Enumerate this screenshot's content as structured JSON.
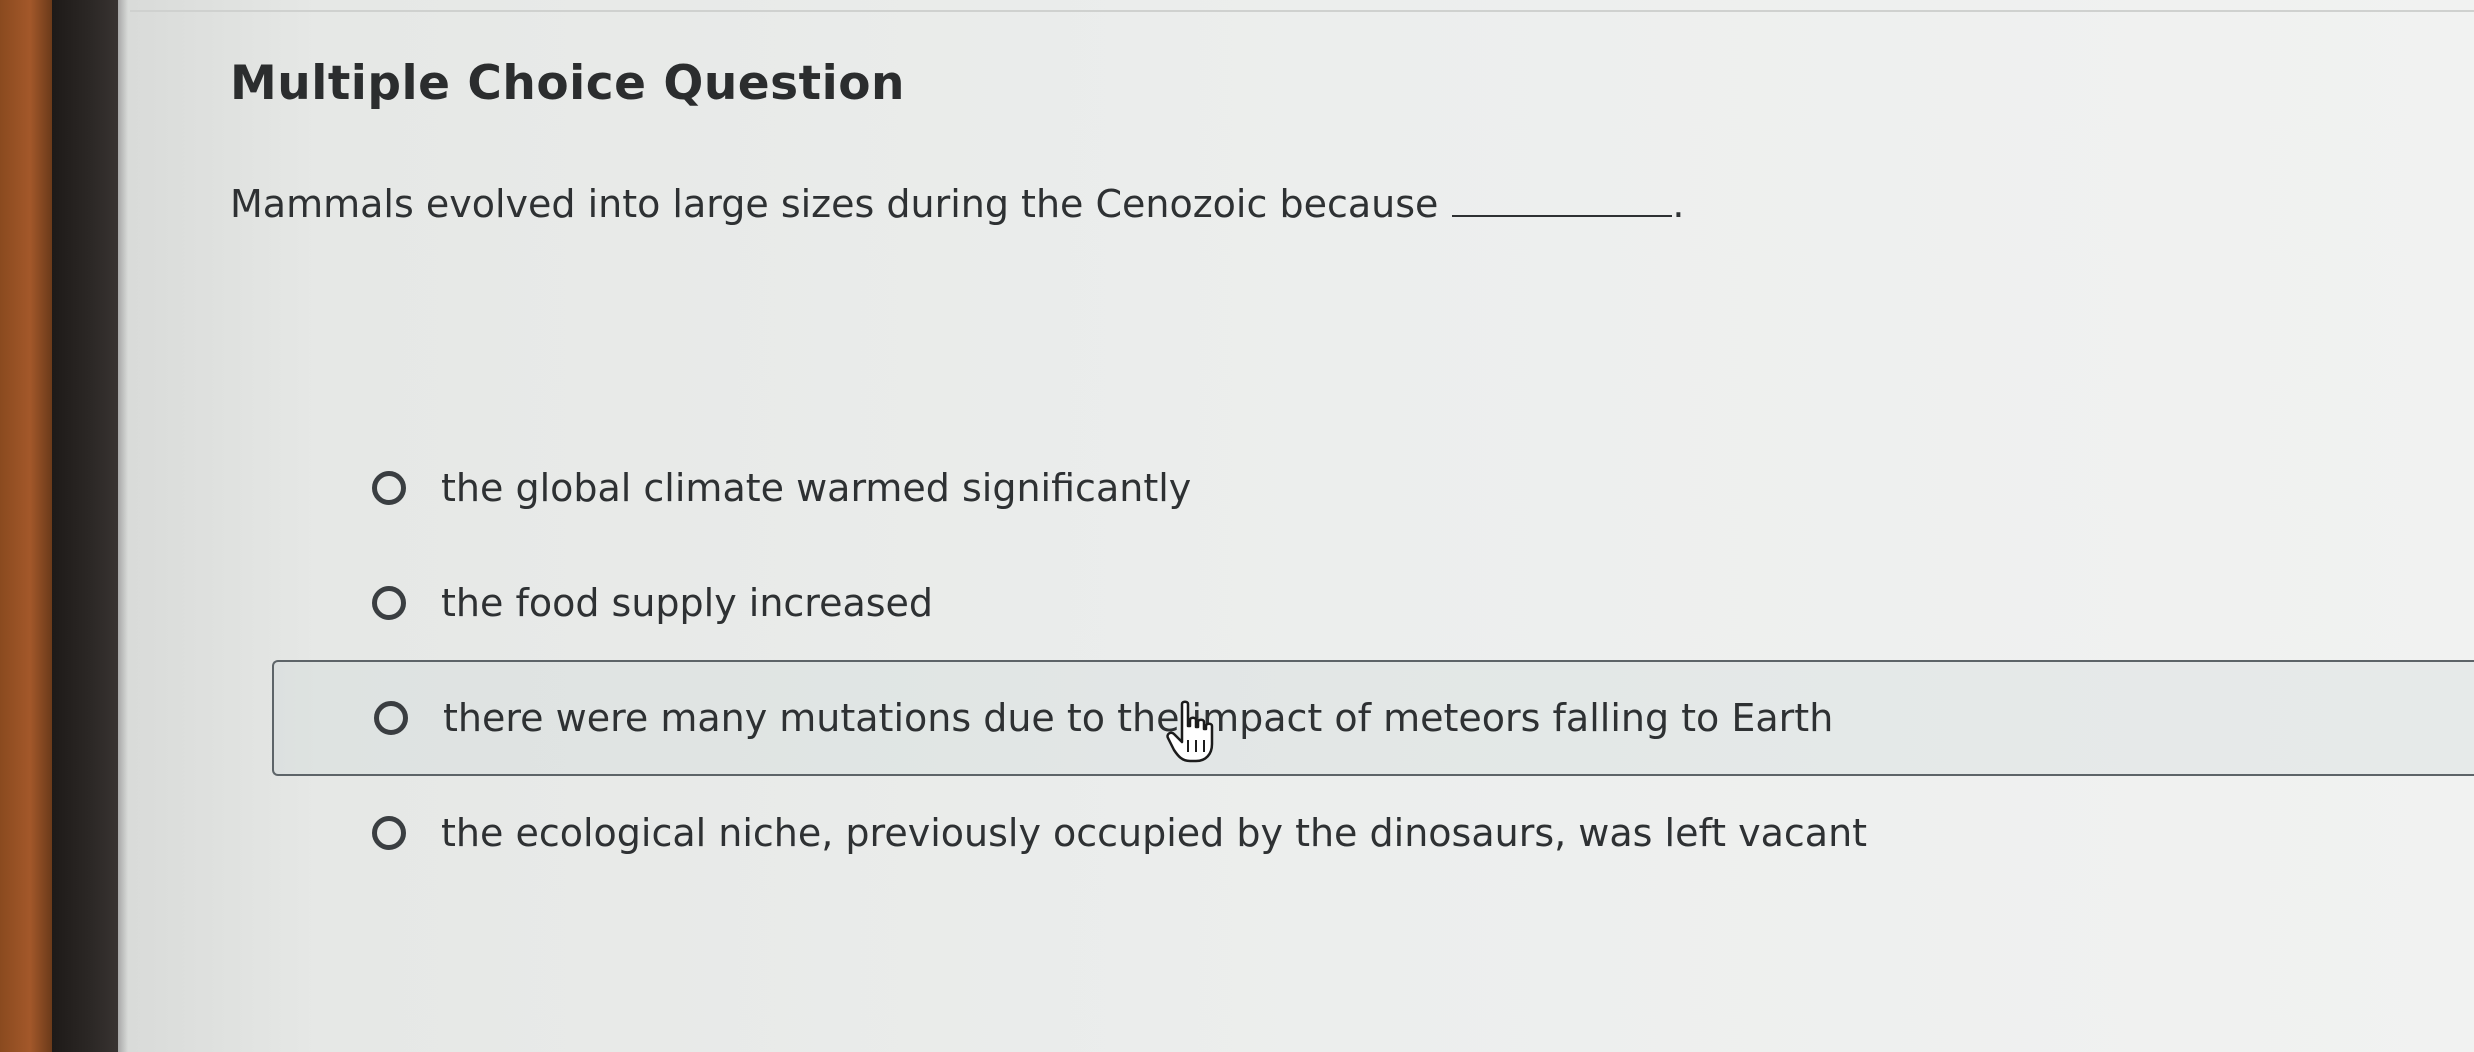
{
  "question_card": {
    "title": "Multiple Choice Question",
    "prompt": "Mammals evolved into large sizes during the Cenozoic because",
    "prompt_end": "."
  },
  "options": [
    {
      "label": "the global climate warmed significantly",
      "selected": false
    },
    {
      "label": "the food supply increased",
      "selected": false
    },
    {
      "label": "there were many mutations due to the impact of meteors falling to Earth",
      "selected": false,
      "hovered": true
    },
    {
      "label": "the ecological niche, previously occupied by the dinosaurs, was left vacant",
      "selected": false
    }
  ],
  "cursor": {
    "icon": "hand-pointer-icon"
  },
  "colors": {
    "text": "#2e3133",
    "title": "#2b2d2e",
    "highlight_border": "#5d6468",
    "background": "#eceeed"
  }
}
